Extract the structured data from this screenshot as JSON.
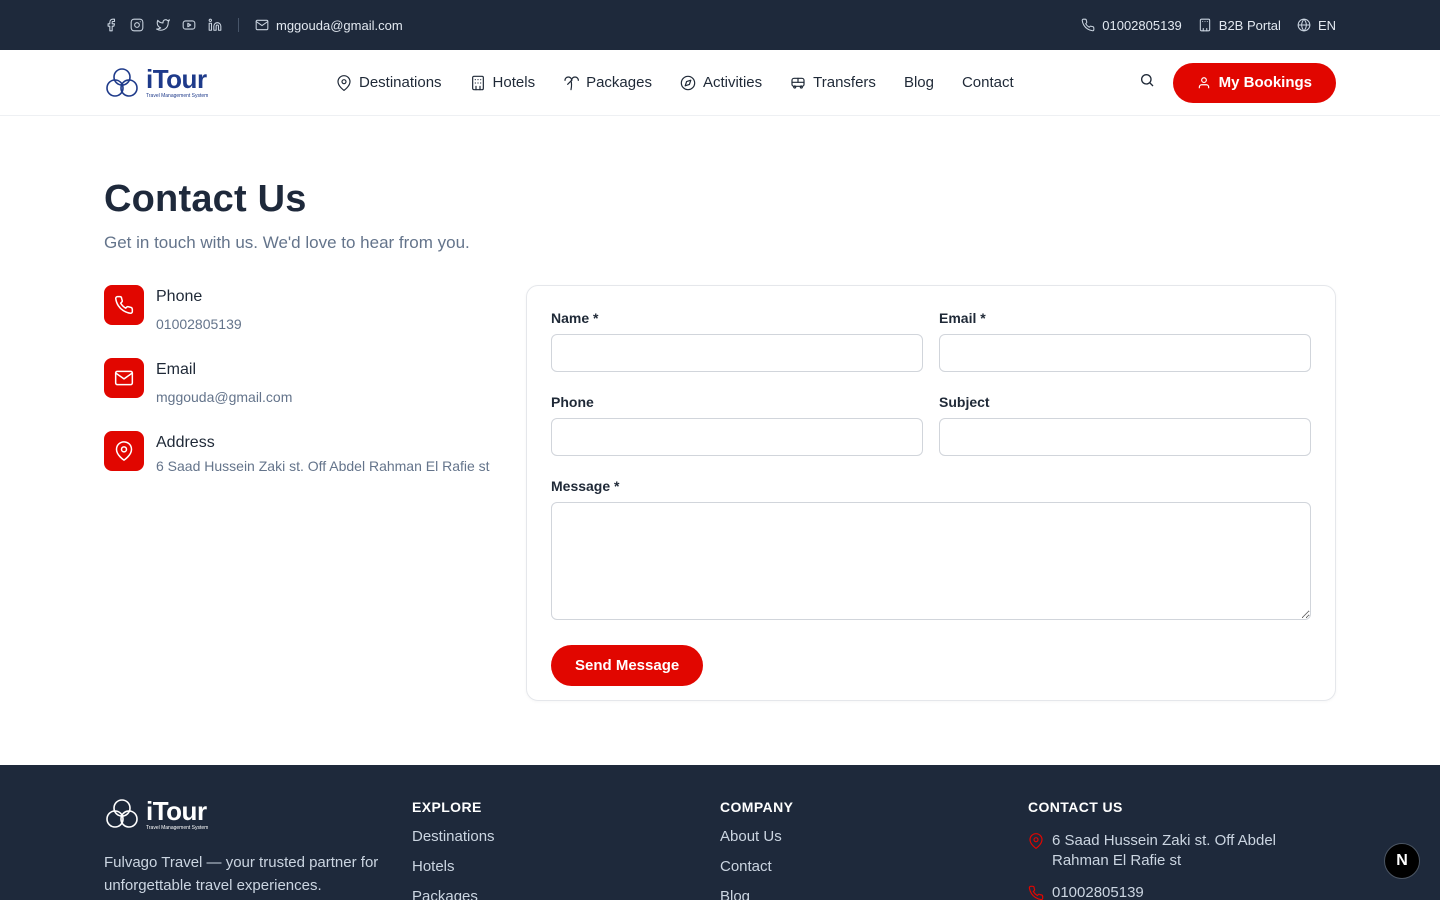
{
  "topbar": {
    "social_icons": [
      "facebook-icon",
      "instagram-icon",
      "twitter-icon",
      "youtube-icon",
      "linkedin-icon"
    ],
    "email": "mggouda@gmail.com",
    "phone": "01002805139",
    "b2b_label": "B2B Portal",
    "language": "EN"
  },
  "header": {
    "logo_name": "iTour",
    "logo_tagline": "Travel Management System",
    "nav": [
      {
        "label": "Destinations",
        "icon": "map-pin-icon"
      },
      {
        "label": "Hotels",
        "icon": "building-icon"
      },
      {
        "label": "Packages",
        "icon": "palm-tree-icon"
      },
      {
        "label": "Activities",
        "icon": "compass-icon"
      },
      {
        "label": "Transfers",
        "icon": "bus-icon"
      },
      {
        "label": "Blog",
        "icon": ""
      },
      {
        "label": "Contact",
        "icon": ""
      }
    ],
    "bookings_label": "My Bookings"
  },
  "main": {
    "title": "Contact Us",
    "subtitle": "Get in touch with us. We'd love to hear from you.",
    "info": [
      {
        "label": "Phone",
        "value": "01002805139",
        "icon": "phone-icon"
      },
      {
        "label": "Email",
        "value": "mggouda@gmail.com",
        "icon": "mail-icon"
      },
      {
        "label": "Address",
        "value": "6 Saad Hussein Zaki st. Off Abdel Rahman El Rafie st",
        "icon": "map-pin-icon"
      }
    ],
    "form": {
      "name_label": "Name *",
      "email_label": "Email *",
      "phone_label": "Phone",
      "subject_label": "Subject",
      "message_label": "Message *",
      "name_value": "",
      "email_value": "",
      "phone_value": "",
      "subject_value": "",
      "message_value": "",
      "submit_label": "Send Message"
    }
  },
  "footer": {
    "logo_name": "iTour",
    "logo_tagline": "Travel Management System",
    "description": "Fulvago Travel — your trusted partner for unforgettable travel experiences.",
    "explore": {
      "heading": "EXPLORE",
      "links": [
        "Destinations",
        "Hotels",
        "Packages"
      ]
    },
    "company": {
      "heading": "COMPANY",
      "links": [
        "About Us",
        "Contact",
        "Blog"
      ]
    },
    "contact": {
      "heading": "CONTACT US",
      "address": "6 Saad Hussein Zaki st. Off Abdel Rahman El Rafie st",
      "phone": "01002805139"
    }
  },
  "dev_badge": "N",
  "colors": {
    "accent": "#e10600",
    "dark": "#1e293b",
    "brand": "#1e3a8a"
  }
}
